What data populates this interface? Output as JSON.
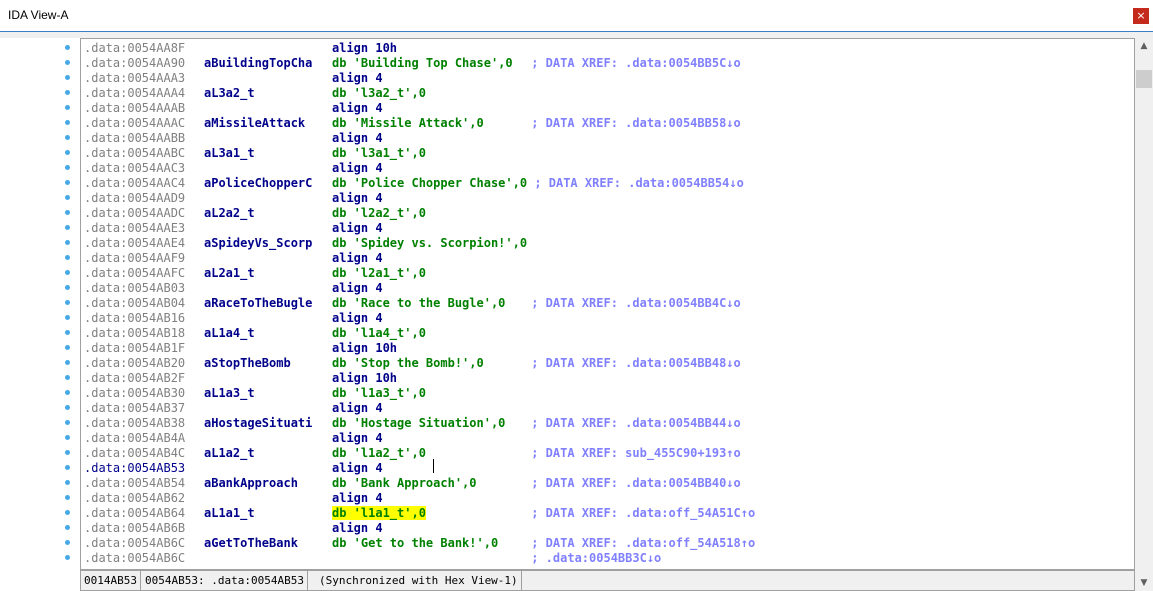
{
  "window": {
    "title": "IDA View-A",
    "close_glyph": "×"
  },
  "lines": [
    {
      "addr": ".data:0054AA8F",
      "label": "",
      "instr": "align 10h"
    },
    {
      "addr": ".data:0054AA90",
      "label": "aBuildingTopCha",
      "instr": "db 'Building Top Chase',0",
      "comment": "; DATA XREF: .data:0054BB5C↓o"
    },
    {
      "addr": ".data:0054AAA3",
      "label": "",
      "instr": "align 4"
    },
    {
      "addr": ".data:0054AAA4",
      "label": "aL3a2_t",
      "instr": "db 'l3a2_t',0"
    },
    {
      "addr": ".data:0054AAAB",
      "label": "",
      "instr": "align 4"
    },
    {
      "addr": ".data:0054AAAC",
      "label": "aMissileAttack",
      "instr": "db 'Missile Attack',0",
      "comment": "; DATA XREF: .data:0054BB58↓o"
    },
    {
      "addr": ".data:0054AABB",
      "label": "",
      "instr": "align 4"
    },
    {
      "addr": ".data:0054AABC",
      "label": "aL3a1_t",
      "instr": "db 'l3a1_t',0"
    },
    {
      "addr": ".data:0054AAC3",
      "label": "",
      "instr": "align 4"
    },
    {
      "addr": ".data:0054AAC4",
      "label": "aPoliceChopperC",
      "instr": "db 'Police Chopper Chase',0",
      "comment": "; DATA XREF: .data:0054BB54↓o"
    },
    {
      "addr": ".data:0054AAD9",
      "label": "",
      "instr": "align 4"
    },
    {
      "addr": ".data:0054AADC",
      "label": "aL2a2_t",
      "instr": "db 'l2a2_t',0"
    },
    {
      "addr": ".data:0054AAE3",
      "label": "",
      "instr": "align 4"
    },
    {
      "addr": ".data:0054AAE4",
      "label": "aSpideyVs_Scorp",
      "instr": "db 'Spidey vs. Scorpion!',0"
    },
    {
      "addr": ".data:0054AAF9",
      "label": "",
      "instr": "align 4"
    },
    {
      "addr": ".data:0054AAFC",
      "label": "aL2a1_t",
      "instr": "db 'l2a1_t',0"
    },
    {
      "addr": ".data:0054AB03",
      "label": "",
      "instr": "align 4"
    },
    {
      "addr": ".data:0054AB04",
      "label": "aRaceToTheBugle",
      "instr": "db 'Race to the Bugle',0",
      "comment": "; DATA XREF: .data:0054BB4C↓o"
    },
    {
      "addr": ".data:0054AB16",
      "label": "",
      "instr": "align 4"
    },
    {
      "addr": ".data:0054AB18",
      "label": "aL1a4_t",
      "instr": "db 'l1a4_t',0"
    },
    {
      "addr": ".data:0054AB1F",
      "label": "",
      "instr": "align 10h"
    },
    {
      "addr": ".data:0054AB20",
      "label": "aStopTheBomb",
      "instr": "db 'Stop the Bomb!',0",
      "comment": "; DATA XREF: .data:0054BB48↓o"
    },
    {
      "addr": ".data:0054AB2F",
      "label": "",
      "instr": "align 10h"
    },
    {
      "addr": ".data:0054AB30",
      "label": "aL1a3_t",
      "instr": "db 'l1a3_t',0"
    },
    {
      "addr": ".data:0054AB37",
      "label": "",
      "instr": "align 4"
    },
    {
      "addr": ".data:0054AB38",
      "label": "aHostageSituati",
      "instr": "db 'Hostage Situation',0",
      "comment": "; DATA XREF: .data:0054BB44↓o"
    },
    {
      "addr": ".data:0054AB4A",
      "label": "",
      "instr": "align 4"
    },
    {
      "addr": ".data:0054AB4C",
      "label": "aL1a2_t",
      "instr": "db 'l1a2_t',0",
      "comment": "; DATA XREF: sub_455C90+193↑o"
    },
    {
      "addr": ".data:0054AB53",
      "label": "",
      "instr": "align 4",
      "current": true
    },
    {
      "addr": ".data:0054AB54",
      "label": "aBankApproach",
      "instr": "db 'Bank Approach',0",
      "comment": "; DATA XREF: .data:0054BB40↓o"
    },
    {
      "addr": ".data:0054AB62",
      "label": "",
      "instr": "align 4"
    },
    {
      "addr": ".data:0054AB64",
      "label": "aL1a1_t",
      "instr": "db 'l1a1_t',0",
      "comment": "; DATA XREF: .data:off_54A51C↑o",
      "highlight": true
    },
    {
      "addr": ".data:0054AB6B",
      "label": "",
      "instr": "align 4"
    },
    {
      "addr": ".data:0054AB6C",
      "label": "aGetToTheBank",
      "instr": "db 'Get to the Bank!',0",
      "comment": "; DATA XREF: .data:off_54A518↑o"
    },
    {
      "addr": ".data:0054AB6C",
      "label": "",
      "instr": "",
      "comment": "; .data:0054BB3C↓o"
    }
  ],
  "status": {
    "offset": "0014AB53",
    "location": "0054AB53: .data:0054AB53",
    "sync": "(Synchronized with Hex View-1)"
  },
  "scroll": {
    "up_glyph": "▲",
    "down_glyph": "▼",
    "position": 0.05
  },
  "colors": {
    "address": "#808080",
    "current_address": "#00008b",
    "keyword": "#00008b",
    "string": "#008000",
    "comment": "#8080ff",
    "highlight": "#ffff00",
    "breakpoint_dot": "#46a8e6"
  }
}
